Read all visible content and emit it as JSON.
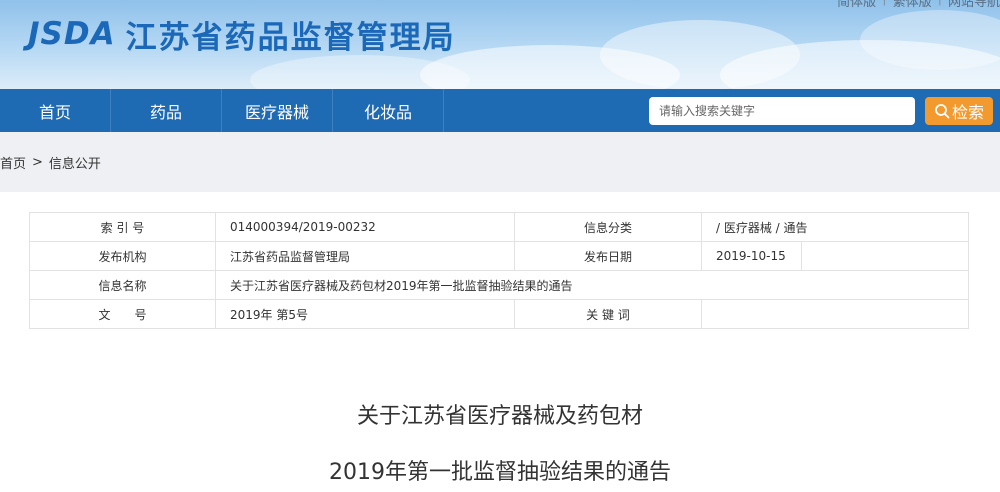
{
  "header": {
    "logo_en": "JSDA",
    "logo_cn": "江苏省药品监督管理局",
    "top_links": [
      "简体版",
      "繁体版",
      "网站导航"
    ]
  },
  "nav": {
    "items": [
      "首页",
      "药品",
      "医疗器械",
      "化妆品"
    ],
    "search_placeholder": "请输入搜索关键字",
    "search_button": "检索"
  },
  "breadcrumb": {
    "home": "首页",
    "separator": ">",
    "current": "信息公开"
  },
  "info": {
    "index_label": "索 引 号",
    "index_value": "014000394/2019-00232",
    "category_label": "信息分类",
    "category_value": "/ 医疗器械 / 通告",
    "org_label": "发布机构",
    "org_value": "江苏省药品监督管理局",
    "date_label": "发布日期",
    "date_value": "2019-10-15",
    "name_label": "信息名称",
    "name_value": "关于江苏省医疗器械及药包材2019年第一批监督抽验结果的通告",
    "doc_label": "文　　号",
    "doc_value": "2019年 第5号",
    "keyword_label": "关 键 词",
    "keyword_value": ""
  },
  "article": {
    "title_line1": "关于江苏省医疗器械及药包材",
    "title_line2": "2019年第一批监督抽验结果的通告"
  },
  "colors": {
    "nav_bg": "#1e6ab3",
    "logo": "#1b67b8",
    "search_button_bg": "#f39a2e",
    "crumb_bg": "#eef0f3"
  }
}
